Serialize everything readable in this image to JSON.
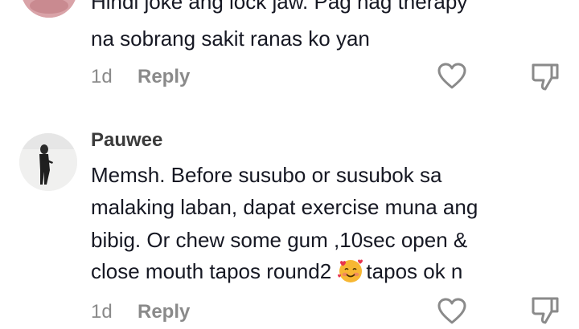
{
  "comment1": {
    "avatar_icon": "avatar-photo-icon",
    "lines": [
      "Hindi joke ang lock jaw. Pag nag therapy",
      "na sobrang sakit ranas ko yan"
    ],
    "time": "1d",
    "reply_label": "Reply"
  },
  "comment2": {
    "avatar_icon": "avatar-photo-icon",
    "username": "Pauwee",
    "lines": [
      "Memsh. Before susubo or susubok sa",
      "malaking laban, dapat exercise muna ang",
      "bibig. Or chew some gum ,10sec open &"
    ],
    "line4_before_emoji": "close mouth tapos round2 ",
    "emoji": "smiling-face-with-hearts-icon",
    "line4_after_emoji": "tapos ok n",
    "time": "1d",
    "reply_label": "Reply"
  },
  "icons": {
    "like": "heart-outline-icon",
    "dislike": "thumbs-down-outline-icon"
  }
}
